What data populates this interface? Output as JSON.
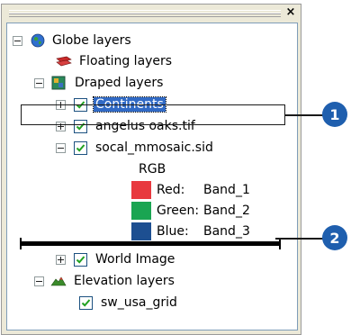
{
  "window": {
    "close_glyph": "×"
  },
  "tree": {
    "globe_layers": {
      "label": "Globe layers"
    },
    "floating_layers": {
      "label": "Floating layers"
    },
    "draped_layers": {
      "label": "Draped layers"
    },
    "continents": {
      "label": "Continents",
      "checked": true,
      "selected": true
    },
    "angelus_oaks": {
      "label": "angelus oaks.tif",
      "checked": true
    },
    "socal_mmosaic": {
      "label": "socal_mmosaic.sid",
      "checked": true
    },
    "rgb_heading": "RGB",
    "bands": [
      {
        "channel": "Red:",
        "band": "Band_1",
        "color": "#e8393f"
      },
      {
        "channel": "Green:",
        "band": "Band_2",
        "color": "#1aa552"
      },
      {
        "channel": "Blue:",
        "band": "Band_3",
        "color": "#1d4f91"
      }
    ],
    "world_image": {
      "label": "World Image",
      "checked": true
    },
    "elevation_layers": {
      "label": "Elevation layers"
    },
    "sw_usa_grid": {
      "label": "sw_usa_grid",
      "checked": true
    }
  },
  "callouts": [
    {
      "number": "1"
    },
    {
      "number": "2"
    }
  ]
}
